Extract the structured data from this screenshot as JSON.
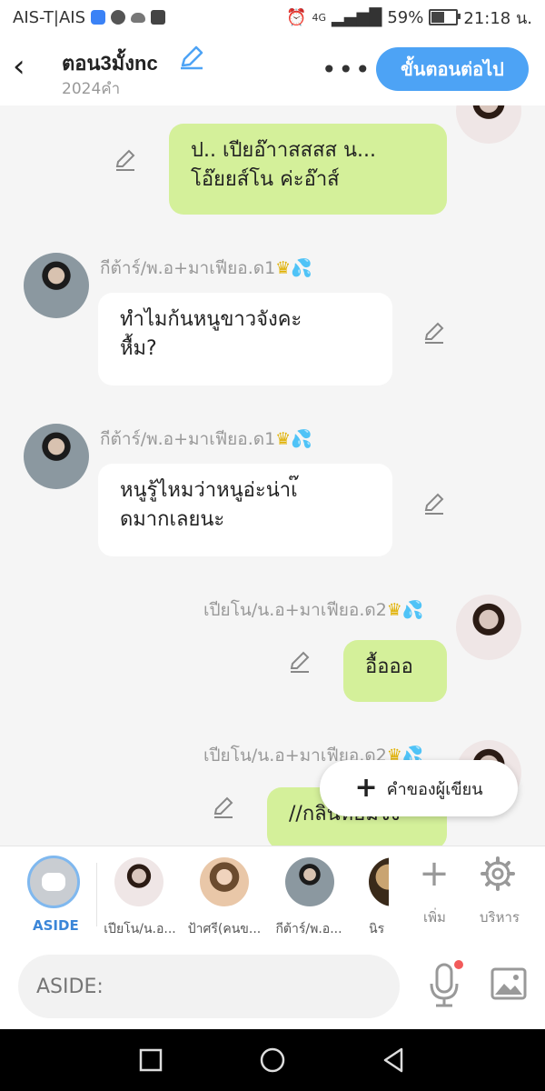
{
  "statusbar": {
    "carrier": "AIS-T|AIS",
    "network": "4G",
    "battery_pct": "59%",
    "battery_level": 0.59,
    "time": "21:18 น."
  },
  "header": {
    "title": "ตอน3มั้งnc",
    "word_count": "2024คำ",
    "more": "•••",
    "next_button": "ขั้นตอนต่อไป"
  },
  "messages": [
    {
      "side": "right",
      "text_lines": [
        "ป.. เปียอ๊าาสสสส น...",
        "โอ๊ยยส์โน ค่ะอ๊าส์"
      ]
    },
    {
      "side": "left",
      "sender": "กีต้าร์/พ.อ+มาเฟียอ.ด1",
      "text_lines": [
        "ทำไมก้นหนูขาวจังคะ",
        "หื้ม?"
      ]
    },
    {
      "side": "left",
      "sender": "กีต้าร์/พ.อ+มาเฟียอ.ด1",
      "text_lines": [
        "หนูรู้ไหมว่าหนูอ่ะน่าเ๊",
        "ดมากเลยนะ"
      ]
    },
    {
      "side": "right",
      "sender": "เปียโน/น.อ+มาเฟียอ.ด2",
      "text_lines": [
        "อื้อออ"
      ]
    },
    {
      "side": "right",
      "sender": "เปียโน/น.อ+มาเฟียอ.ด2",
      "text_lines": [
        "//กลิ่นหอมจัง"
      ]
    }
  ],
  "author_button": "คำของผู้เขียน",
  "character_bar": {
    "aside_label": "ASIDE",
    "characters": [
      {
        "label": "เปียโน/น.อ..."
      },
      {
        "label": "ป้าศรี(คนข..."
      },
      {
        "label": "กีต้าร์/พ.อ..."
      },
      {
        "label": "นิร"
      }
    ],
    "add_label": "เพิ่ม",
    "manage_label": "บริหาร"
  },
  "input": {
    "placeholder": "ASIDE:"
  },
  "colors": {
    "accent": "#4da3f5",
    "green_bubble": "#d4f09a",
    "aside_blue": "#3b86d8"
  }
}
